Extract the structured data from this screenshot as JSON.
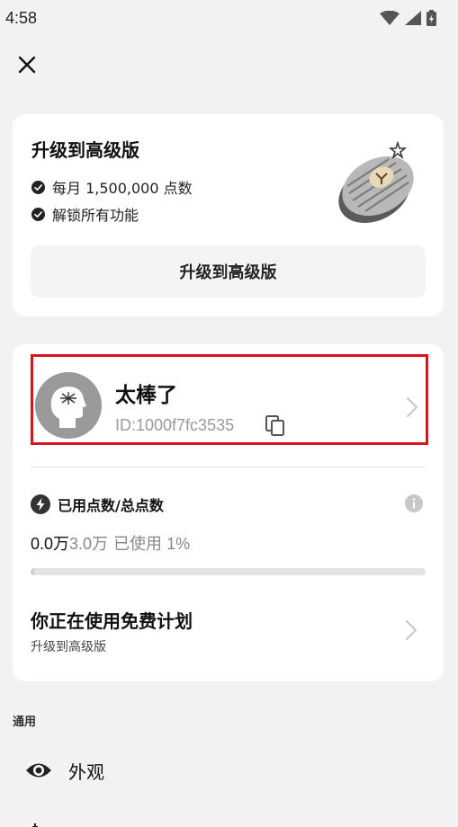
{
  "status_bar": {
    "time": "4:58",
    "icons": [
      "wifi-icon",
      "signal-icon",
      "battery-icon"
    ]
  },
  "header": {
    "close_icon": "close-icon"
  },
  "upgrade_card": {
    "title": "升级到高级版",
    "features": [
      "每月 1,500,000 点数",
      "解锁所有功能"
    ],
    "button_label": "升级到高级版",
    "image": "premium-coin-icon"
  },
  "account_card": {
    "username": "太棒了",
    "user_id": "ID:1000f7fc3535",
    "points_label": "已用点数/总点数",
    "points_used": "0.0万",
    "points_total": "3.0万",
    "points_used_text": "已使用 1%",
    "progress_fraction": 0.01,
    "plan_title": "你正在使用免费计划",
    "plan_subtitle": "升级到高级版",
    "highlight_color": "#d9141f"
  },
  "general_section": {
    "title": "通用",
    "items": [
      {
        "label": "外观",
        "icon": "eye-icon"
      }
    ]
  }
}
